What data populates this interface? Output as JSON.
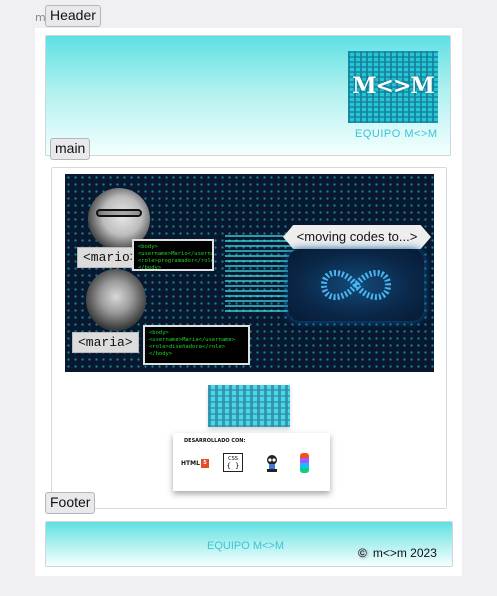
{
  "stray_label": "m",
  "labels": {
    "header": "Header",
    "main": "main",
    "footer": "Footer"
  },
  "header": {
    "logo_text": "M<>M",
    "logo_icon": "mm-logo-icon",
    "team_name": "EQUIPO M<>M"
  },
  "hero": {
    "member1_tag": "<mario>",
    "member1_code": "<body>\n<username>Mario</username>\n<role>programador</role>\n</body>",
    "member2_tag": "<maria>",
    "member2_code": "<body>\n<username>Maria</username>\n<role>diseñadora</role>\n</body>",
    "moving_tag": "<moving codes to...>",
    "infinity_icon": "infinity-icon"
  },
  "qr_icon": "qr-code-icon",
  "dev_card": {
    "title": "DESARROLLADO CON:",
    "tools": [
      {
        "name": "HTML",
        "icon": "html5-icon"
      },
      {
        "name": "CSS",
        "icon": "css3-icon"
      },
      {
        "name": "GitHub",
        "icon": "github-icon"
      },
      {
        "name": "Figma",
        "icon": "figma-icon"
      }
    ],
    "html_badge": "5",
    "css_label": "CSS",
    "css_brace": "{ }"
  },
  "footer": {
    "team_name": "EQUIPO M<>M",
    "copyright_symbol": "©",
    "copyright_text": "m<>m 2023"
  },
  "colors": {
    "accent_cyan": "#5ee0e2",
    "team_text": "#3cc4d6",
    "hero_bg": "#07182f",
    "code_green": "#23d327"
  }
}
